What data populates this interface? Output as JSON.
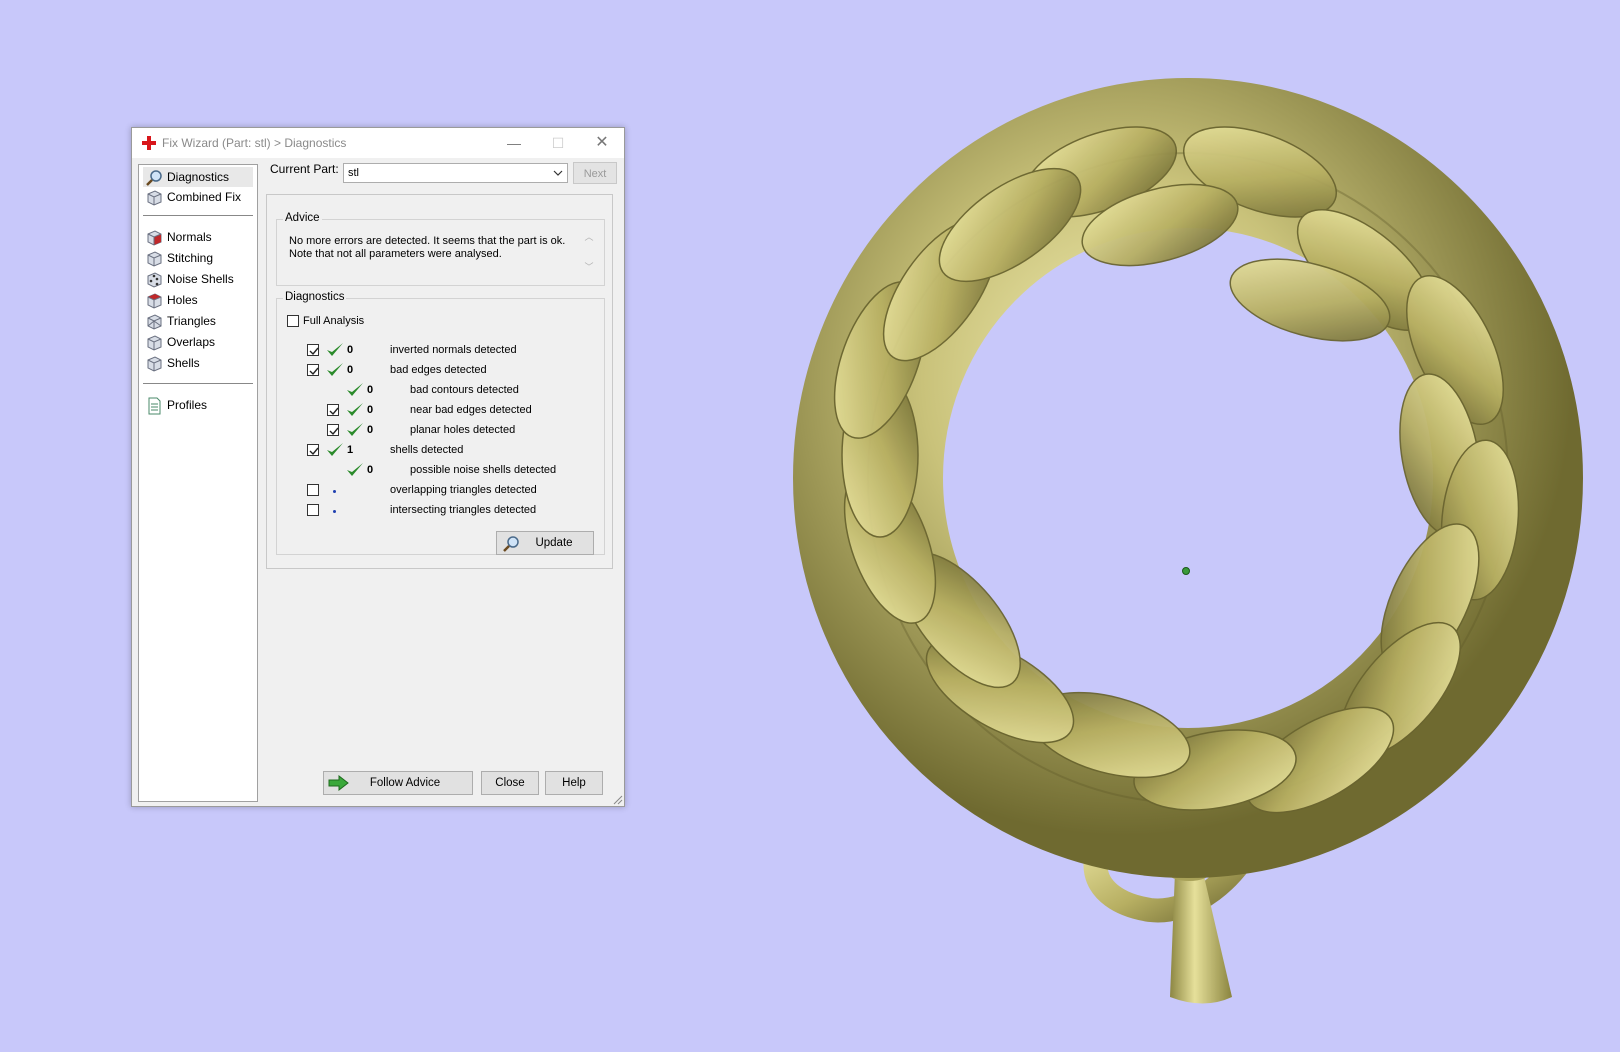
{
  "window": {
    "title": "Fix Wizard (Part: stl) > Diagnostics",
    "minimize_glyph": "—",
    "maximize_glyph": "☐",
    "close_glyph": "✕"
  },
  "nav": {
    "items": [
      {
        "label": "Diagnostics",
        "icon": "magnifier-icon"
      },
      {
        "label": "Combined Fix",
        "icon": "cube-icon"
      },
      {
        "label": "Normals",
        "icon": "cube-red-face-icon"
      },
      {
        "label": "Stitching",
        "icon": "cube-icon"
      },
      {
        "label": "Noise Shells",
        "icon": "cube-dots-icon"
      },
      {
        "label": "Holes",
        "icon": "cube-red-face-icon"
      },
      {
        "label": "Triangles",
        "icon": "cube-icon"
      },
      {
        "label": "Overlaps",
        "icon": "cube-icon"
      },
      {
        "label": "Shells",
        "icon": "cube-icon"
      },
      {
        "label": "Profiles",
        "icon": "document-icon"
      }
    ]
  },
  "current_part": {
    "label": "Current Part:",
    "value": "stl",
    "next_label": "Next"
  },
  "advice": {
    "title": "Advice",
    "text": "No more errors are detected. It seems that the part is ok. Note that not all parameters were analysed."
  },
  "diagnostics": {
    "title": "Diagnostics",
    "full_analysis_label": "Full Analysis",
    "rows": [
      {
        "label": "inverted normals detected",
        "value": "0"
      },
      {
        "label": "bad edges detected",
        "value": "0"
      },
      {
        "label": "bad contours detected",
        "value": "0"
      },
      {
        "label": "near bad edges detected",
        "value": "0"
      },
      {
        "label": "planar holes detected",
        "value": "0"
      },
      {
        "label": "shells detected",
        "value": "1"
      },
      {
        "label": "possible noise shells detected",
        "value": "0"
      },
      {
        "label": "overlapping triangles detected",
        "value": ""
      },
      {
        "label": "intersecting triangles detected",
        "value": ""
      }
    ],
    "update_label": "Update"
  },
  "footer": {
    "follow_advice_label": "Follow Advice",
    "close_label": "Close",
    "help_label": "Help"
  },
  "colors": {
    "viewport_bg": "#c8c8fa",
    "model_gold": "#c9c27a",
    "check_green": "#2a8a2a"
  }
}
